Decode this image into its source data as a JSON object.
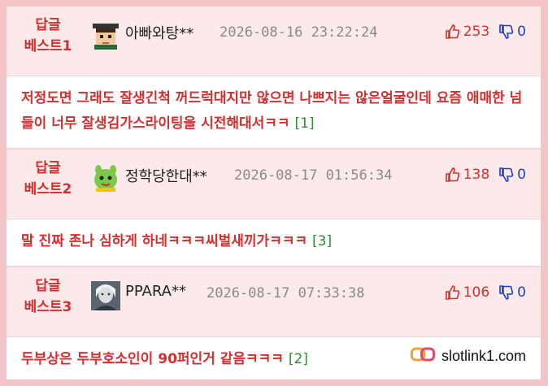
{
  "comments": [
    {
      "rank_line1": "답글",
      "rank_line2": "베스트1",
      "nickname": "아빠와탕**",
      "date": "2026-08-16 23:22:24",
      "upvotes": "253",
      "downvotes": "0",
      "text": "저정도면 그래도 잘생긴척 꺼드럭대지만 않으면 나쁘지는 않은얼굴인데 요즘 애매한 넘들이 너무 잘생김가스라이팅을 시전해대서ㅋㅋ",
      "reply_count": "[1]",
      "avatar_icon": "pixel-face-avatar-icon"
    },
    {
      "rank_line1": "답글",
      "rank_line2": "베스트2",
      "nickname": "정학당한대**",
      "date": "2026-08-17 01:56:34",
      "upvotes": "138",
      "downvotes": "0",
      "text": "말 진짜 존나 심하게 하네ㅋㅋㅋ씨벌새끼가ㅋㅋㅋ",
      "reply_count": "[3]",
      "avatar_icon": "green-character-avatar-icon"
    },
    {
      "rank_line1": "답글",
      "rank_line2": "베스트3",
      "nickname": "PPARA**",
      "date": "2026-08-17 07:33:38",
      "upvotes": "106",
      "downvotes": "0",
      "text": "두부상은 두부호소인이 90퍼인거 같음ㅋㅋㅋ",
      "reply_count": "[2]",
      "avatar_icon": "photo-avatar-icon"
    }
  ],
  "watermark": {
    "text": "slotlink1.com",
    "icon": "link-logo-icon"
  },
  "colors": {
    "accent_red": "#d32f2f",
    "downvote_blue": "#1f3fbf",
    "reply_green": "#2e8b2e",
    "header_bg": "#fce9ea",
    "frame_bg": "#f2c4c6"
  }
}
